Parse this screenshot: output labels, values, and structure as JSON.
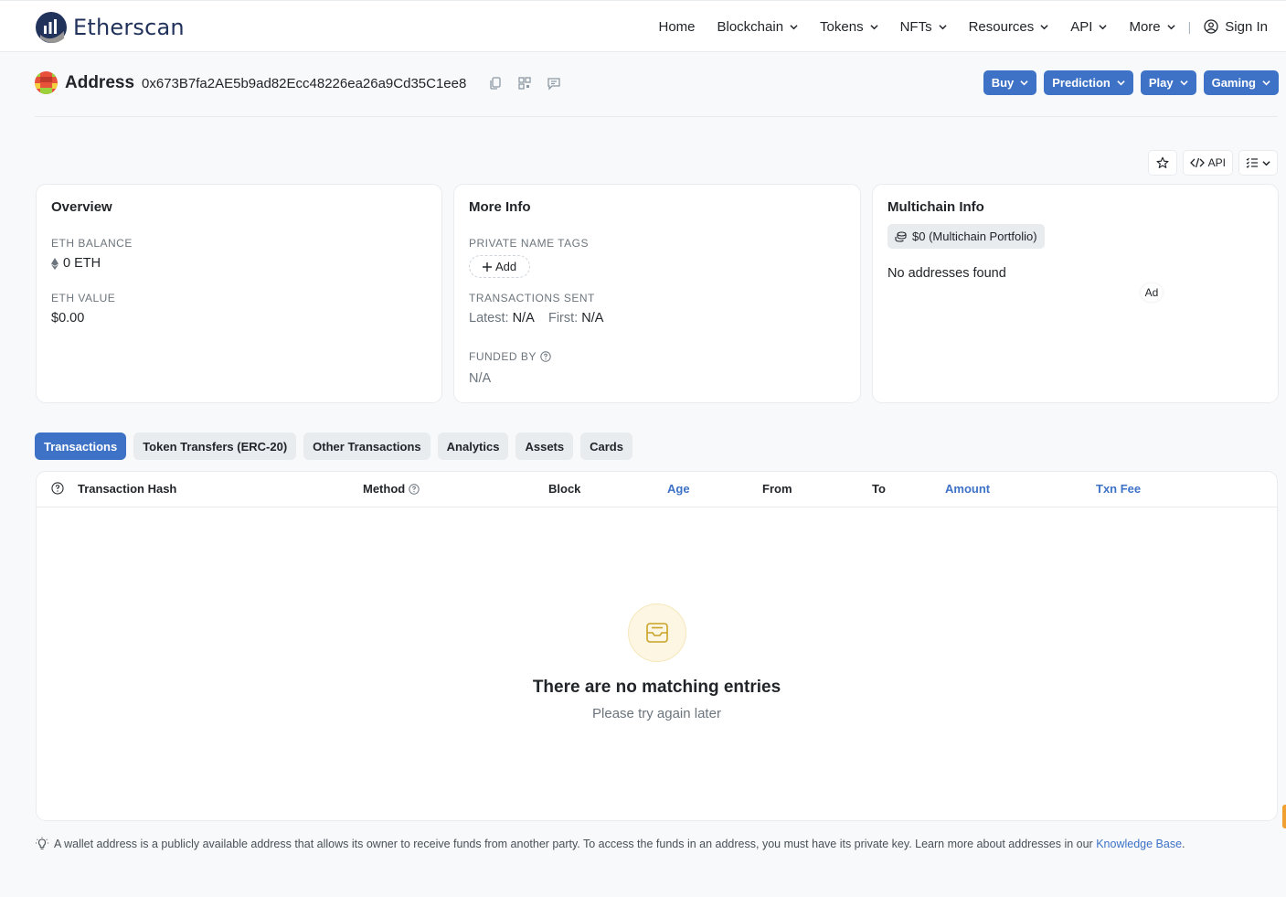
{
  "brand": {
    "name": "Etherscan"
  },
  "nav": {
    "items": [
      {
        "label": "Home",
        "dropdown": false
      },
      {
        "label": "Blockchain",
        "dropdown": true
      },
      {
        "label": "Tokens",
        "dropdown": true
      },
      {
        "label": "NFTs",
        "dropdown": true
      },
      {
        "label": "Resources",
        "dropdown": true
      },
      {
        "label": "API",
        "dropdown": true
      },
      {
        "label": "More",
        "dropdown": true
      }
    ],
    "signin": "Sign In"
  },
  "address": {
    "title": "Address",
    "hash": "0x673B7fa2AE5b9ad82Ecc48226ea26a9Cd35C1ee8"
  },
  "top_buttons": [
    "Buy",
    "Prediction",
    "Play",
    "Gaming"
  ],
  "tools": {
    "api": "API"
  },
  "overview": {
    "title": "Overview",
    "eth_balance_label": "ETH BALANCE",
    "eth_balance": "0 ETH",
    "eth_value_label": "ETH VALUE",
    "eth_value": "$0.00"
  },
  "more_info": {
    "title": "More Info",
    "tags_label": "PRIVATE NAME TAGS",
    "add_label": "Add",
    "tx_sent_label": "TRANSACTIONS SENT",
    "latest_label": "Latest:",
    "latest_value": "N/A",
    "first_label": "First:",
    "first_value": "N/A",
    "funded_label": "FUNDED BY",
    "funded_value": "N/A"
  },
  "multichain": {
    "title": "Multichain Info",
    "portfolio": "$0 (Multichain Portfolio)",
    "no_addresses": "No addresses found",
    "ad": "Ad"
  },
  "tabs": [
    {
      "label": "Transactions",
      "active": true
    },
    {
      "label": "Token Transfers (ERC-20)",
      "active": false
    },
    {
      "label": "Other Transactions",
      "active": false
    },
    {
      "label": "Analytics",
      "active": false
    },
    {
      "label": "Assets",
      "active": false
    },
    {
      "label": "Cards",
      "active": false
    }
  ],
  "table": {
    "columns": [
      "Transaction Hash",
      "Method",
      "Block",
      "Age",
      "From",
      "To",
      "Amount",
      "Txn Fee"
    ],
    "empty_title": "There are no matching entries",
    "empty_sub": "Please try again later"
  },
  "footer": {
    "note": "A wallet address is a publicly available address that allows its owner to receive funds from another party. To access the funds in an address, you must have its private key. Learn more about addresses in our",
    "link": "Knowledge Base",
    "end": "."
  },
  "colors": {
    "accent": "#3d72c6",
    "brand": "#21325b"
  }
}
